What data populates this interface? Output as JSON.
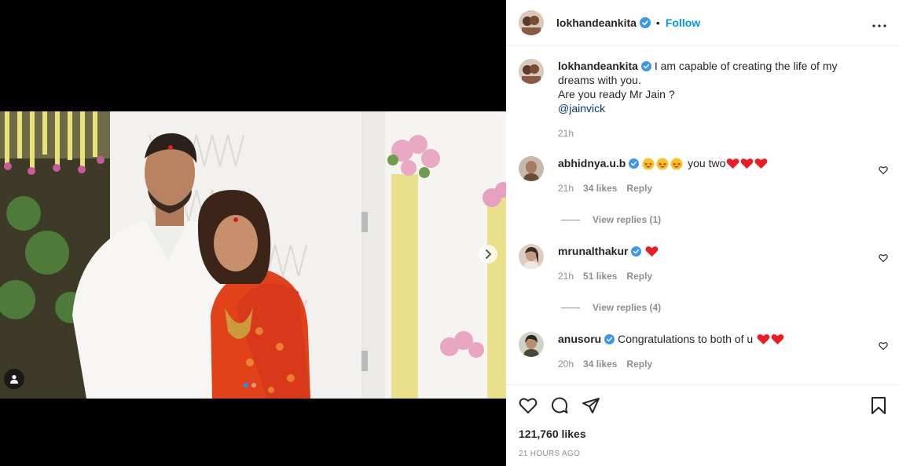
{
  "header": {
    "username": "lokhandeankita",
    "separator": "•",
    "follow_label": "Follow",
    "more_label": "•••"
  },
  "caption": {
    "username": "lokhandeankita",
    "line1": "I am capable of creating the life of my dreams with you.",
    "line2": "Are you ready Mr Jain ?",
    "mention": "@jainvick",
    "time": "21h"
  },
  "comments": [
    {
      "username": "abhidnya.u.b",
      "text": "you two",
      "time": "21h",
      "likes": "34 likes",
      "reply_label": "Reply",
      "view_replies": "View replies (1)"
    },
    {
      "username": "mrunalthakur",
      "text": "",
      "time": "21h",
      "likes": "51 likes",
      "reply_label": "Reply",
      "view_replies": "View replies (4)"
    },
    {
      "username": "anusoru",
      "text": "Congratulations to both of u",
      "time": "20h",
      "likes": "34 likes",
      "reply_label": "Reply"
    }
  ],
  "likes_count": "121,760 likes",
  "posted_ago": "21 HOURS AGO",
  "colors": {
    "accent": "#0095f6",
    "verified": "#3897f0",
    "heart": "#ed1c24",
    "mention": "#00376b",
    "muted": "#8e8e8e"
  },
  "icons": [
    "verified-badge-icon",
    "more-options-icon",
    "heart-icon",
    "comment-icon",
    "share-icon",
    "save-icon",
    "chevron-right-icon",
    "user-tag-icon"
  ]
}
